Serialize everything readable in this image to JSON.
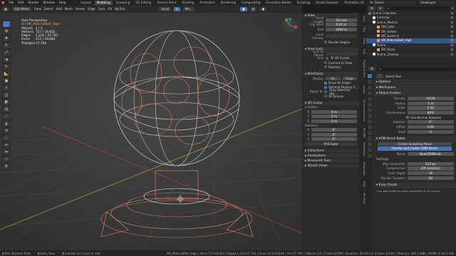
{
  "menubar": {
    "items": [
      "File",
      "Edit",
      "Render",
      "Window",
      "Help"
    ],
    "workspaces": [
      "Layout",
      "Modeling",
      "Sculpting",
      "UV Editing",
      "Texture Paint",
      "Shading",
      "Animation",
      "Rendering",
      "Compositing",
      "Geometry Nodes",
      "Scripting",
      "Assets Browser",
      "Animation 02",
      "Node Editors"
    ],
    "active_workspace": "Modeling",
    "scene": "Scene",
    "view_layer": "ViewLayer"
  },
  "viewport_header": {
    "mode": "Edit Mode",
    "menus": [
      "View",
      "Select",
      "Add",
      "Mesh",
      "Vertex",
      "Edge",
      "Face",
      "UV",
      "MyTool"
    ],
    "orientation": "Local",
    "snap": "Mo..."
  },
  "overlay": {
    "view_name": "User Perspective",
    "object_name": "(0) SM_MaterialBall_High",
    "stats": [
      {
        "k": "Objects",
        "v": "1 / 3"
      },
      {
        "k": "Vertices",
        "v": "727 / 18,922"
      },
      {
        "k": "Edges",
        "v": "1,231 / 57,742"
      },
      {
        "k": "Faces",
        "v": "511 / 18,844"
      },
      {
        "k": "Triangles",
        "v": "37,784"
      }
    ]
  },
  "npanel": {
    "view": {
      "title": "View",
      "focal_label": "Focal Length",
      "focal": "50 mm",
      "clip_label": "Clip Start",
      "clip_start": "0.01 m",
      "end_label": "End",
      "clip_end": "1000 m",
      "local_camera_label": "Local Camera",
      "render_region": "Render Region"
    },
    "view_lock": {
      "title": "View Lock",
      "lock_object_label": "Lock to Object",
      "lock_label": "Lock",
      "to_3d_cursor": "To 3D Cursor",
      "camera_to_view": "Camera to View",
      "rotation": "Rotation"
    },
    "wireframe": {
      "title": "Wireframe",
      "display_label": "Display",
      "on": "On",
      "clear": "Clear",
      "draw_all_edges": "Draw All Edges",
      "optimal_display": "Optimal Display S...",
      "apply_label": "Apply To",
      "only_selected": "Only Selected Obj...",
      "all_scenes": "All Scenes"
    },
    "cursor": {
      "title": "3D Cursor",
      "location_label": "Location:",
      "loc": [
        {
          "axis": "X",
          "val": "0 m"
        },
        {
          "axis": "Y",
          "val": "0 m"
        },
        {
          "axis": "Z",
          "val": "0 m"
        }
      ],
      "rotation_label": "Rotation:",
      "rot": [
        {
          "axis": "X",
          "val": "0°"
        },
        {
          "axis": "Y",
          "val": "0°"
        },
        {
          "axis": "Z",
          "val": "0°"
        }
      ],
      "mode": "XYZ Euler"
    },
    "collapsed": [
      "Collections",
      "Annotations",
      "MeasureIt Tools",
      "Stored Views"
    ]
  },
  "vtabs": [
    "Item",
    "Tool",
    "View",
    "Edit",
    "Shortcut VUr",
    "Create",
    "Screencast Keys",
    "BY-GEN",
    "Wireframe",
    "MeasureIt",
    "Edit",
    "3D-Print"
  ],
  "outliner": {
    "search": "",
    "rows": [
      {
        "label": "Scene Collection",
        "indent": 0,
        "icon": "#777",
        "tail": ""
      },
      {
        "label": "Cameras",
        "indent": 1,
        "icon": "#e0e0e0",
        "tail": ""
      },
      {
        "label": "Scene_Meshes",
        "indent": 1,
        "icon": "#e0e0e0",
        "tail": ""
      },
      {
        "label": "SM_Cube",
        "indent": 2,
        "icon": "#f0a35a",
        "tail": ""
      },
      {
        "label": "SM_Hollow",
        "indent": 2,
        "icon": "#f0a35a",
        "tail": ""
      },
      {
        "label": "SM_Suzanne",
        "indent": 2,
        "icon": "#f0a35a",
        "tail": ""
      },
      {
        "label": "SM_MaterialBall_High",
        "indent": 2,
        "icon": "#f0a35a",
        "tail": "",
        "sel": true
      },
      {
        "label": "Scene",
        "indent": 1,
        "icon": "#e0e0e0",
        "tail": ""
      },
      {
        "label": "SM_Stone",
        "indent": 2,
        "icon": "#f0a35a",
        "tail": ""
      },
      {
        "label": "Scene_Cleanup",
        "indent": 1,
        "icon": "#e0e0e0",
        "tail": ""
      }
    ]
  },
  "properties": {
    "object_label": "Select Box",
    "sections": {
      "options": "Options",
      "workspace": "Workspace",
      "scatter": "Object Scatter",
      "brush_baker": "VDM Brush Baker",
      "settings": "Settings",
      "easy_clouds": "Easy Clouds"
    },
    "scatter_fields": [
      {
        "k": "Density",
        "v": "10.00"
      },
      {
        "k": "Radius",
        "v": "1 m"
      },
      {
        "k": "Scale",
        "v": "0.50"
      },
      {
        "k": "Randomness",
        "v": "80%"
      }
    ],
    "use_normal_rotation": "Use Normal Rotation",
    "rotation_fields": [
      {
        "k": "Rotation",
        "v": "0°"
      },
      {
        "k": "Offset",
        "v": "0.00"
      },
      {
        "k": "Seed",
        "v": "0"
      }
    ],
    "create_sculpting_plane": "Create Sculpting Plane",
    "render_vdm_button": "Render and Create VDM Brush",
    "name_label": "Name",
    "name_value": "NewVDMBrush",
    "baker_fields": [
      {
        "k": "Map Resolution",
        "v": "512 px"
      },
      {
        "k": "Compression",
        "v": "ZIP (lossless)"
      },
      {
        "k": "Color Depth",
        "v": "16"
      },
      {
        "k": "Render Samples",
        "v": "64"
      }
    ],
    "clouds_hint": "Use add mode to show monoliths of the clouds"
  },
  "statusbar": {
    "items": [
      "Pick Shortest Path",
      "Dolly View",
      "Extrude to Cursor or Add"
    ],
    "stats": "SM_MaterialBall_High | Verts:727/18,922 | Edges:1,231/57,742 | Faces:511/18,844 | Tris:37,784 | Objects:1/3 | Frame:0/100 | Duration: 00:03+12 (Frame 0/100) | Memory: 395.1 MiB | VRAM: 0.3/4.0 GiB",
    "version": "3.6.0"
  }
}
